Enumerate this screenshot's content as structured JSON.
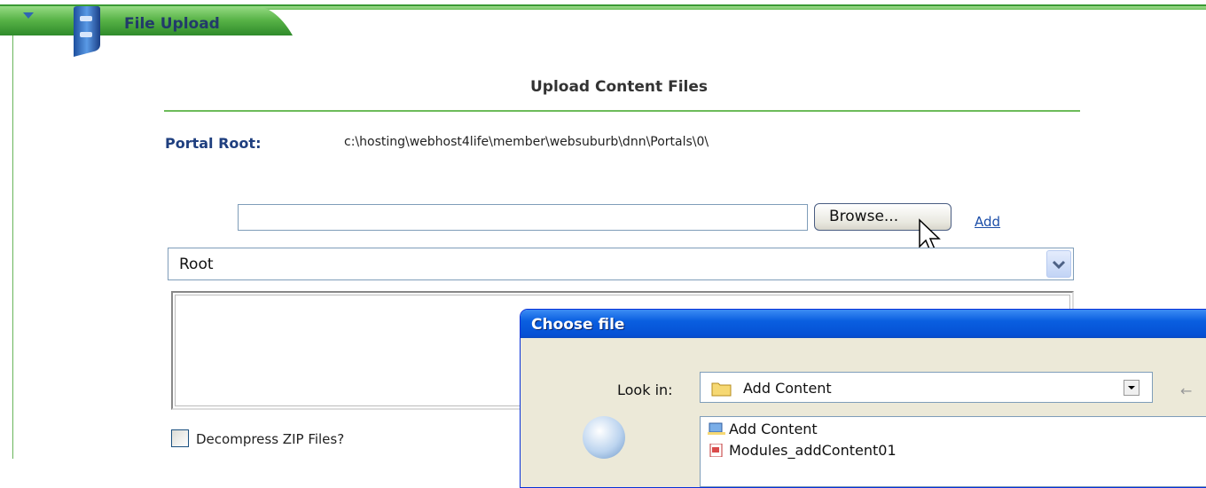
{
  "module": {
    "title": "File Upload"
  },
  "upload": {
    "section_title": "Upload Content Files",
    "portal_root_label": "Portal Root:",
    "portal_root_value": "c:\\hosting\\webhost4life\\member\\websuburb\\dnn\\Portals\\0\\",
    "file_input_value": "",
    "browse_label": "Browse...",
    "add_label": "Add",
    "folder_selected": "Root",
    "decompress_label": "Decompress ZIP Files?",
    "decompress_checked": false
  },
  "dialog": {
    "title": "Choose file",
    "look_in_label": "Look in:",
    "look_in_value": "Add Content",
    "items": [
      "Add Content",
      "Modules_addContent01"
    ]
  },
  "colors": {
    "accent_green": "#6dbb5a",
    "title_blue": "#1f3f7f",
    "dialog_titlebar": "#0550d4"
  }
}
